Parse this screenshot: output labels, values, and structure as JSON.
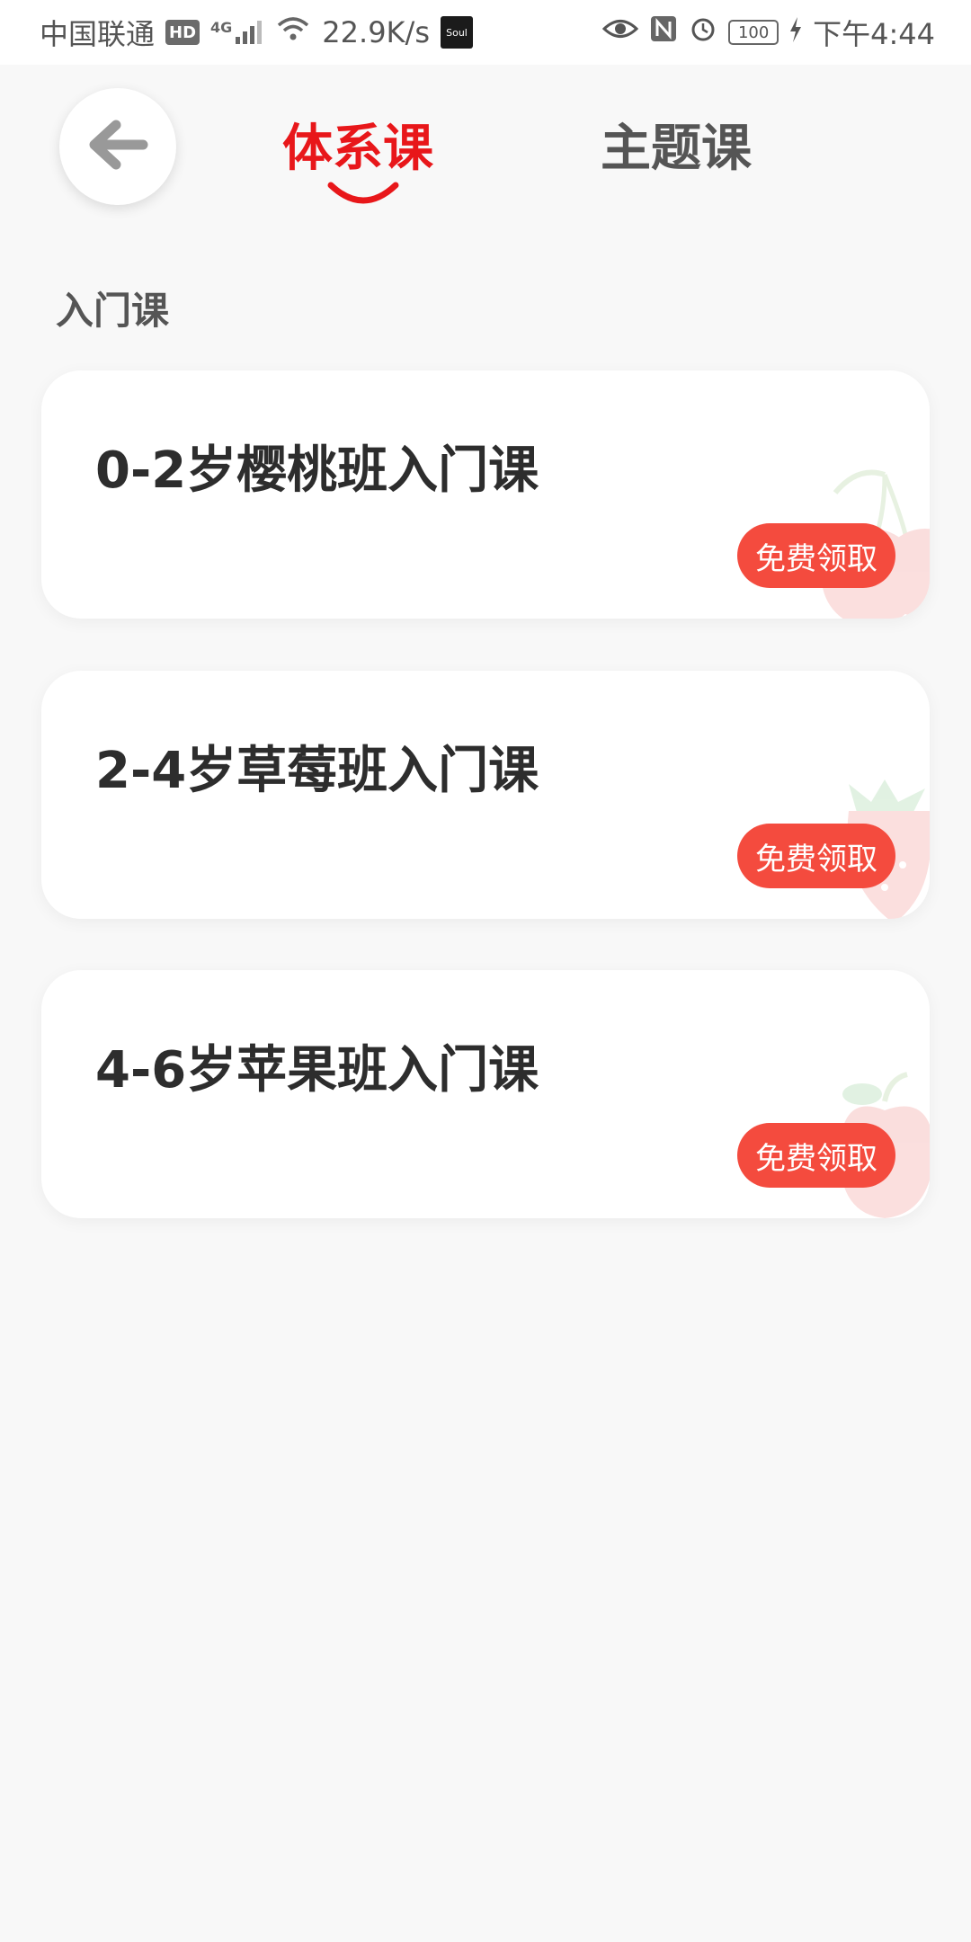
{
  "status_bar": {
    "carrier": "中国联通",
    "hd_badge": "HD",
    "network": "4G",
    "speed": "22.9K/s",
    "app_icon": "Soul",
    "battery": "100",
    "time": "下午4:44"
  },
  "header": {
    "back_icon": "arrow-left-icon",
    "tabs": [
      {
        "label": "体系课",
        "active": true
      },
      {
        "label": "主题课",
        "active": false
      }
    ],
    "accent_color": "#e8171a"
  },
  "section": {
    "title": "入门课"
  },
  "courses": [
    {
      "title": "0-2岁樱桃班入门课",
      "button": "免费领取",
      "art": "cherry-illustration"
    },
    {
      "title": "2-4岁草莓班入门课",
      "button": "免费领取",
      "art": "strawberry-illustration"
    },
    {
      "title": "4-6岁苹果班入门课",
      "button": "免费领取",
      "art": "apple-illustration"
    }
  ],
  "button_color": "#f44b3e"
}
